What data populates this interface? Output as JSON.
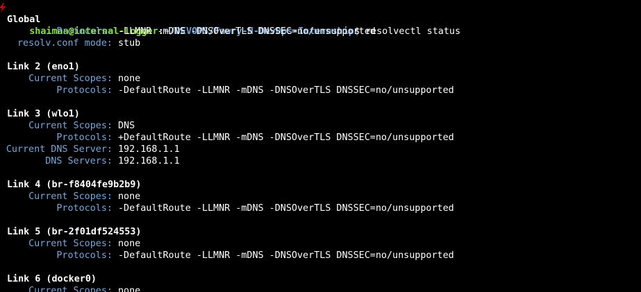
{
  "prompt": {
    "user_host": "shaimaa@internal-logger",
    "separator": ":",
    "path": "~/DEVOPS/Fawry-N-DevOps-Internship",
    "symbol": "$",
    "command": "resolvectl status"
  },
  "global": {
    "title": "Global",
    "protocols_key": "Protocols:",
    "protocols_val": "-LLMNR -mDNS -DNSOverTLS DNSSEC=no/unsupported",
    "resolv_key": "resolv.conf mode:",
    "resolv_val": "stub"
  },
  "link2": {
    "title": "Link 2 (eno1)",
    "scopes_key": "Current Scopes:",
    "scopes_val": "none",
    "protocols_key": "Protocols:",
    "protocols_val": "-DefaultRoute -LLMNR -mDNS -DNSOverTLS DNSSEC=no/unsupported"
  },
  "link3": {
    "title": "Link 3 (wlo1)",
    "scopes_key": "Current Scopes:",
    "scopes_val": "DNS",
    "protocols_key": "Protocols:",
    "protocols_val": "+DefaultRoute -LLMNR -mDNS -DNSOverTLS DNSSEC=no/unsupported",
    "dns_server_key": "Current DNS Server:",
    "dns_server_val": "192.168.1.1",
    "dns_servers_key": "DNS Servers:",
    "dns_servers_val": "192.168.1.1"
  },
  "link4": {
    "title": "Link 4 (br-f8404fe9b2b9)",
    "scopes_key": "Current Scopes:",
    "scopes_val": "none",
    "protocols_key": "Protocols:",
    "protocols_val": "-DefaultRoute -LLMNR -mDNS -DNSOverTLS DNSSEC=no/unsupported"
  },
  "link5": {
    "title": "Link 5 (br-2f01df524553)",
    "scopes_key": "Current Scopes:",
    "scopes_val": "none",
    "protocols_key": "Protocols:",
    "protocols_val": "-DefaultRoute -LLMNR -mDNS -DNSOverTLS DNSSEC=no/unsupported"
  },
  "link6": {
    "title": "Link 6 (docker0)",
    "scopes_key": "Current Scopes:",
    "scopes_val": "none"
  },
  "colors": {
    "background": "#000000",
    "user_host": "#8ae234",
    "path": "#729fcf",
    "key": "#7aa7d8",
    "text": "#ffffff",
    "indicator": "#cc0000"
  },
  "icons": {
    "status_indicator": "lightning-bolt-icon"
  }
}
